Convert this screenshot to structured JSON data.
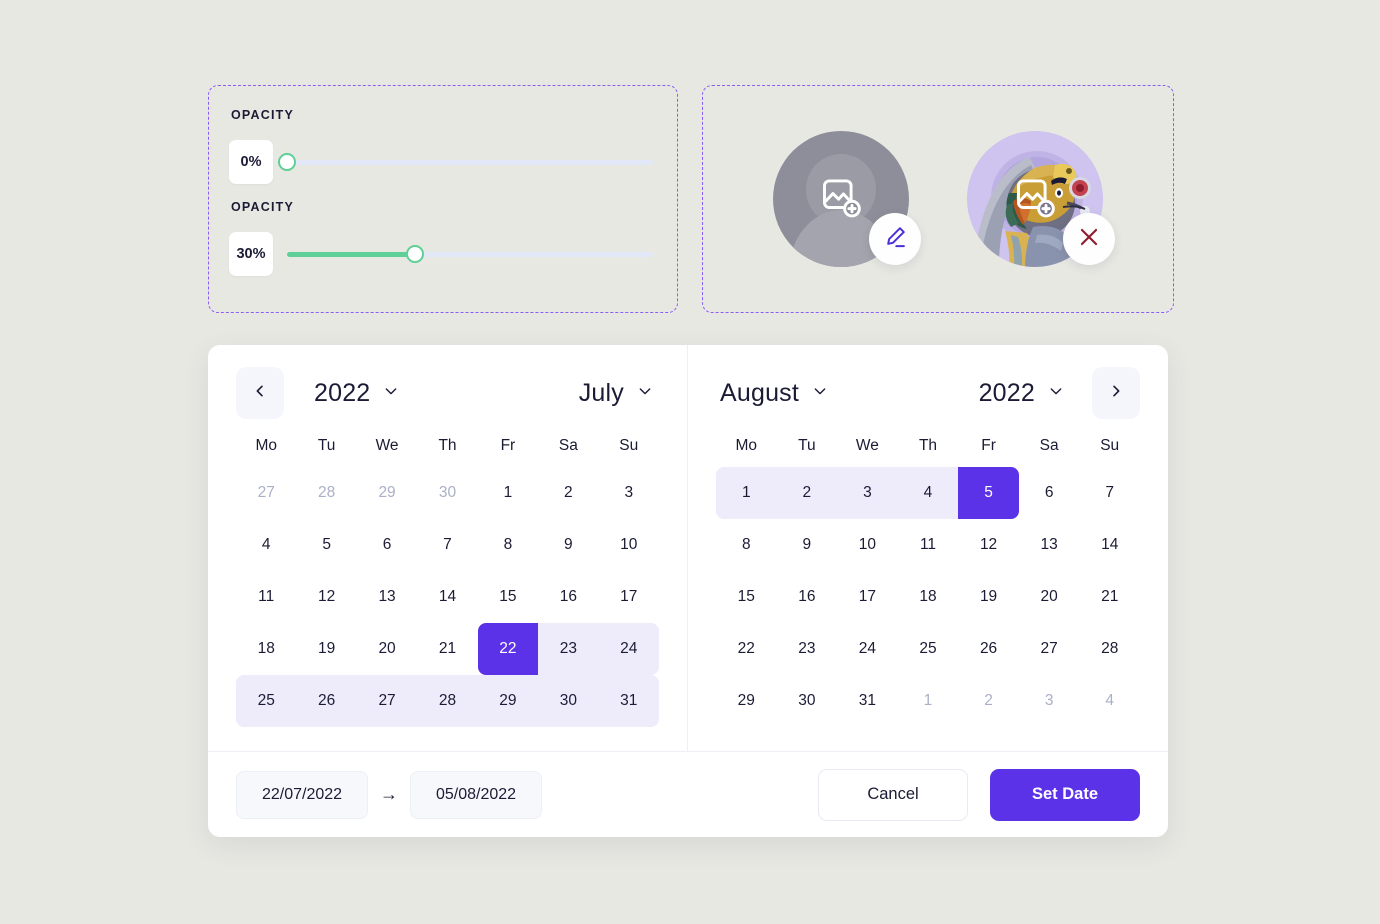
{
  "sliders": {
    "items": [
      {
        "label": "OPACITY",
        "value": "0%",
        "percent": 0,
        "thumb_icon": "slider-thumb-handle"
      },
      {
        "label": "OPACITY",
        "value": "30%",
        "percent": 35,
        "thumb_icon": "slider-thumb-handle"
      }
    ],
    "track_color": "#e2e8f8",
    "fill_color": "#5fcf98"
  },
  "avatars": {
    "items": [
      {
        "kind": "placeholder",
        "overlay_icon": "image-plus-icon",
        "action_icon": "pencil-edit-icon",
        "action_color": "#4b2fd6"
      },
      {
        "kind": "photo",
        "overlay_icon": "image-plus-icon",
        "action_icon": "close-x-icon",
        "action_color": "#8f1d2c"
      }
    ]
  },
  "calendar": {
    "accent": "#5b32e8",
    "range_bg": "#eeebfb",
    "prev_icon": "chevron-left-icon",
    "next_icon": "chevron-right-icon",
    "chevron_icon": "chevron-down-icon",
    "dow": [
      "Mo",
      "Tu",
      "We",
      "Th",
      "Fr",
      "Sa",
      "Su"
    ],
    "left": {
      "year": "2022",
      "month": "July",
      "weeks": [
        [
          {
            "n": "27",
            "s": "muted"
          },
          {
            "n": "28",
            "s": "muted"
          },
          {
            "n": "29",
            "s": "muted"
          },
          {
            "n": "30",
            "s": "muted"
          },
          {
            "n": "1",
            "s": ""
          },
          {
            "n": "2",
            "s": ""
          },
          {
            "n": "3",
            "s": ""
          }
        ],
        [
          {
            "n": "4",
            "s": ""
          },
          {
            "n": "5",
            "s": ""
          },
          {
            "n": "6",
            "s": ""
          },
          {
            "n": "7",
            "s": ""
          },
          {
            "n": "8",
            "s": ""
          },
          {
            "n": "9",
            "s": ""
          },
          {
            "n": "10",
            "s": ""
          }
        ],
        [
          {
            "n": "11",
            "s": ""
          },
          {
            "n": "12",
            "s": ""
          },
          {
            "n": "13",
            "s": ""
          },
          {
            "n": "14",
            "s": ""
          },
          {
            "n": "15",
            "s": ""
          },
          {
            "n": "16",
            "s": ""
          },
          {
            "n": "17",
            "s": ""
          }
        ],
        [
          {
            "n": "18",
            "s": ""
          },
          {
            "n": "19",
            "s": ""
          },
          {
            "n": "20",
            "s": ""
          },
          {
            "n": "21",
            "s": ""
          },
          {
            "n": "22",
            "s": "selected sel-start"
          },
          {
            "n": "23",
            "s": "inrange"
          },
          {
            "n": "24",
            "s": "inrange range-end-edge"
          }
        ],
        [
          {
            "n": "25",
            "s": "inrange range-start-edge"
          },
          {
            "n": "26",
            "s": "inrange"
          },
          {
            "n": "27",
            "s": "inrange"
          },
          {
            "n": "28",
            "s": "inrange"
          },
          {
            "n": "29",
            "s": "inrange"
          },
          {
            "n": "30",
            "s": "inrange"
          },
          {
            "n": "31",
            "s": "inrange range-end-edge"
          }
        ]
      ]
    },
    "right": {
      "year": "2022",
      "month": "August",
      "weeks": [
        [
          {
            "n": "1",
            "s": "inrange range-start-edge"
          },
          {
            "n": "2",
            "s": "inrange"
          },
          {
            "n": "3",
            "s": "inrange"
          },
          {
            "n": "4",
            "s": "inrange"
          },
          {
            "n": "5",
            "s": "selected sel-end"
          },
          {
            "n": "6",
            "s": ""
          },
          {
            "n": "7",
            "s": ""
          }
        ],
        [
          {
            "n": "8",
            "s": ""
          },
          {
            "n": "9",
            "s": ""
          },
          {
            "n": "10",
            "s": ""
          },
          {
            "n": "11",
            "s": ""
          },
          {
            "n": "12",
            "s": ""
          },
          {
            "n": "13",
            "s": ""
          },
          {
            "n": "14",
            "s": ""
          }
        ],
        [
          {
            "n": "15",
            "s": ""
          },
          {
            "n": "16",
            "s": ""
          },
          {
            "n": "17",
            "s": ""
          },
          {
            "n": "18",
            "s": ""
          },
          {
            "n": "19",
            "s": ""
          },
          {
            "n": "20",
            "s": ""
          },
          {
            "n": "21",
            "s": ""
          }
        ],
        [
          {
            "n": "22",
            "s": ""
          },
          {
            "n": "23",
            "s": ""
          },
          {
            "n": "24",
            "s": ""
          },
          {
            "n": "25",
            "s": ""
          },
          {
            "n": "26",
            "s": ""
          },
          {
            "n": "27",
            "s": ""
          },
          {
            "n": "28",
            "s": ""
          }
        ],
        [
          {
            "n": "29",
            "s": ""
          },
          {
            "n": "30",
            "s": ""
          },
          {
            "n": "31",
            "s": ""
          },
          {
            "n": "1",
            "s": "muted"
          },
          {
            "n": "2",
            "s": "muted"
          },
          {
            "n": "3",
            "s": "muted"
          },
          {
            "n": "4",
            "s": "muted"
          }
        ]
      ]
    },
    "footer": {
      "start_date": "22/07/2022",
      "end_date": "05/08/2022",
      "separator": "→",
      "cancel_label": "Cancel",
      "confirm_label": "Set Date"
    }
  }
}
